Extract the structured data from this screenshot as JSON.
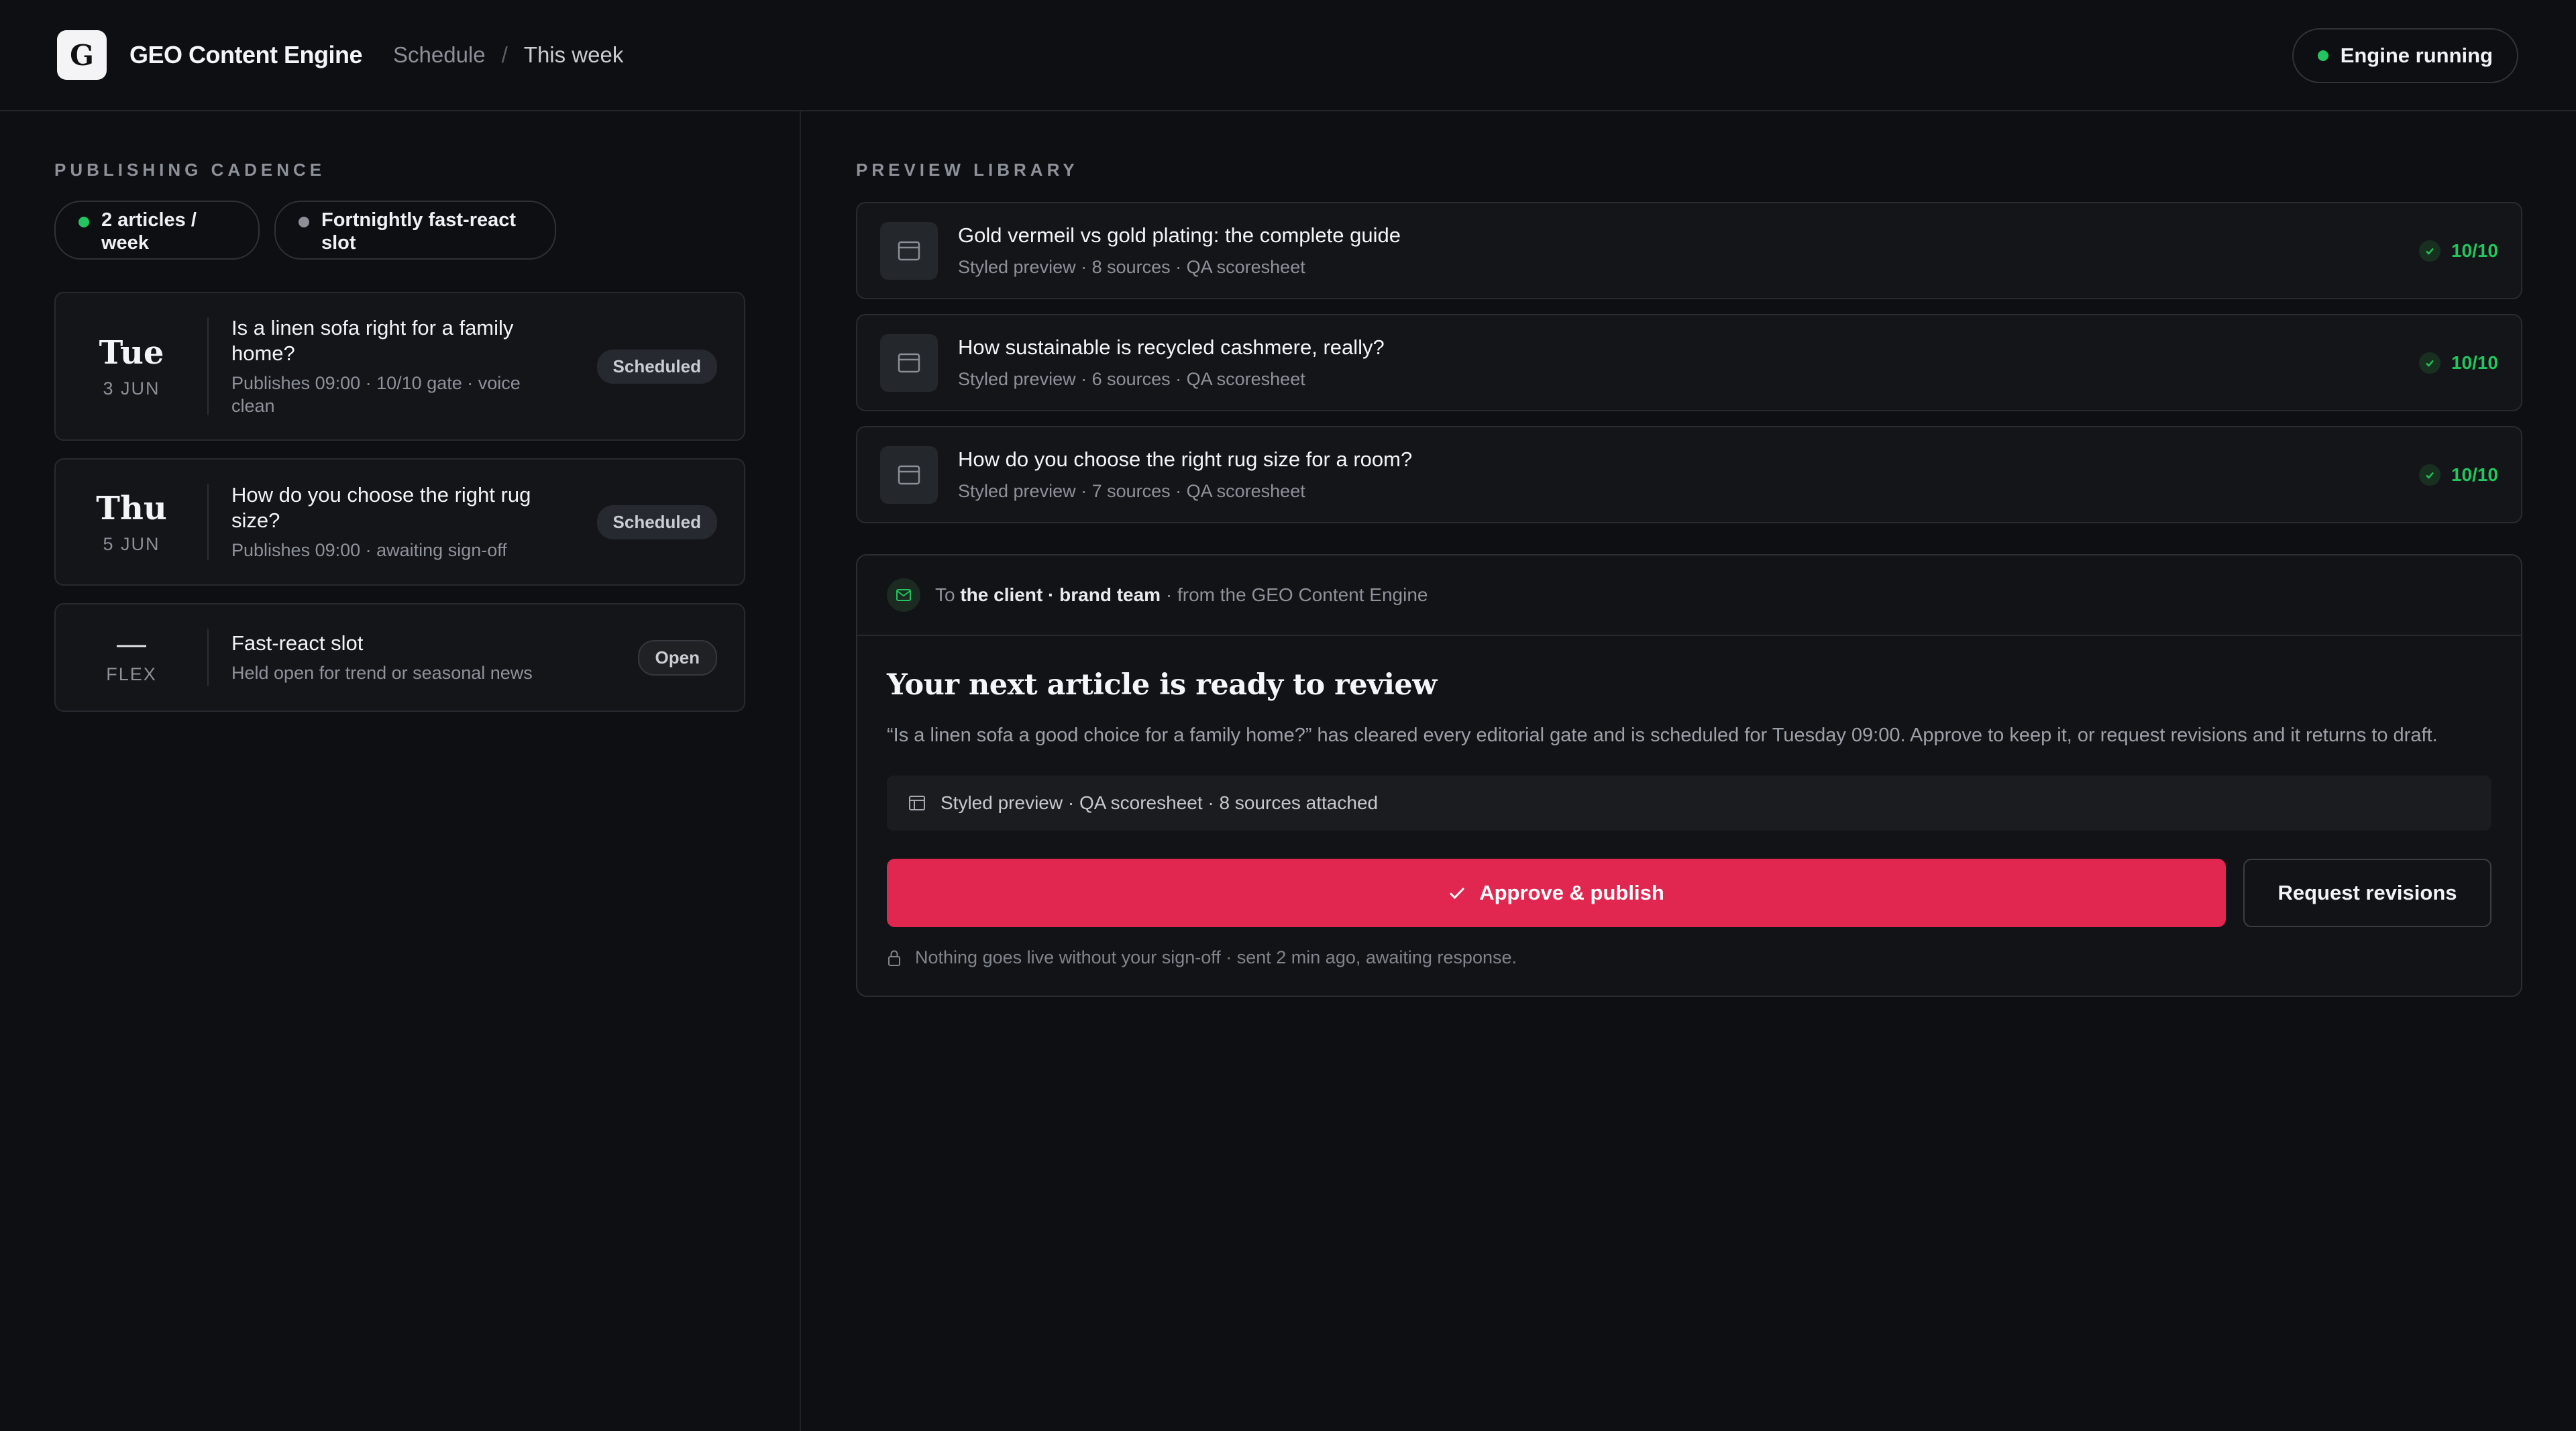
{
  "header": {
    "logo_letter": "G",
    "app_title": "GEO Content Engine",
    "breadcrumb": {
      "section": "Schedule",
      "separator": "/",
      "current": "This week"
    },
    "status": {
      "label": "Engine running",
      "color": "#22c55e"
    }
  },
  "cadence": {
    "section_label": "PUBLISHING CADENCE",
    "chips": [
      {
        "label": "2 articles / week",
        "dot": "green"
      },
      {
        "label": "Fortnightly fast-react slot",
        "dot": "grey"
      }
    ],
    "schedule": [
      {
        "day": "Tue",
        "date": "3 JUN",
        "title": "Is a linen sofa right for a family home?",
        "meta": "Publishes 09:00 · 10/10 gate · voice clean",
        "badge": "Scheduled"
      },
      {
        "day": "Thu",
        "date": "5 JUN",
        "title": "How do you choose the right rug size?",
        "meta": "Publishes 09:00 · awaiting sign-off",
        "badge": "Scheduled"
      },
      {
        "day": "—",
        "date": "FLEX",
        "title": "Fast-react slot",
        "meta": "Held open for trend or seasonal news",
        "badge": "Open"
      }
    ]
  },
  "library": {
    "section_label": "PREVIEW LIBRARY",
    "items": [
      {
        "title": "Gold vermeil vs gold plating: the complete guide",
        "meta": "Styled preview · 8 sources · QA scoresheet",
        "score": "10/10"
      },
      {
        "title": "How sustainable is recycled cashmere, really?",
        "meta": "Styled preview · 6 sources · QA scoresheet",
        "score": "10/10"
      },
      {
        "title": "How do you choose the right rug size for a room?",
        "meta": "Styled preview · 7 sources · QA scoresheet",
        "score": "10/10"
      }
    ]
  },
  "email": {
    "to_prefix": "To",
    "recipient": "the client · brand team",
    "from_suffix": "· from the GEO Content Engine",
    "title": "Your next article is ready to review",
    "body": "“Is a linen sofa a good choice for a family home?” has cleared every editorial gate and is scheduled for Tuesday 09:00. Approve to keep it, or request revisions and it returns to draft.",
    "attachments": "Styled preview · QA scoresheet · 8 sources attached",
    "approve_label": "Approve & publish",
    "revise_label": "Request revisions",
    "footnote": "Nothing goes live without your sign-off · sent 2 min ago, awaiting response.",
    "accent_color": "#e1264f"
  }
}
